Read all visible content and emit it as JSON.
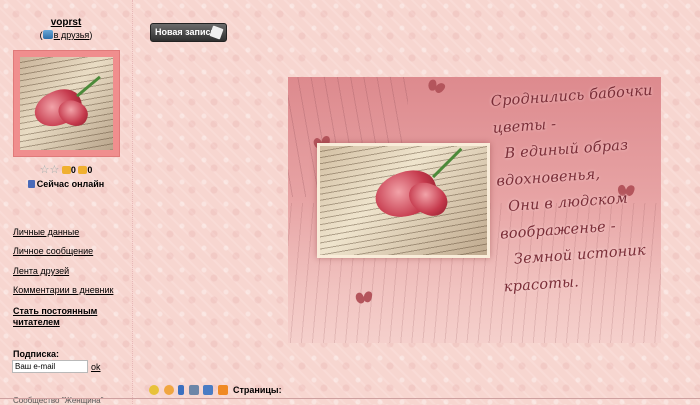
{
  "profile": {
    "username": "voprst",
    "add_friends_label": "в друзья",
    "open_paren": "(",
    "close_paren": ")",
    "stats": {
      "count_a": "0",
      "count_b": "0"
    },
    "online_status": "Сейчас онлайн"
  },
  "nav": {
    "items": [
      "Личные данные",
      "Личное сообщение",
      "Лента друзей",
      "Комментарии в дневник",
      "Стать постоянным читателем"
    ]
  },
  "subscribe": {
    "label": "Подписка:",
    "email_value": "Ваш e-mail",
    "ok_label": "ok",
    "cutoff_text": "Сообщество \"Женщина\""
  },
  "toolbar": {
    "new_post_label": "Новая запись",
    "pages_label": "Страницы:"
  },
  "post": {
    "poem_lines": [
      "Сроднились бабочки",
      "цветы -",
      "В единый образ",
      "вдохновенья,",
      "Они в людском",
      "воображенье -",
      "Земной истоник",
      "красоты."
    ]
  },
  "colors": {
    "background": "#f7d6d0",
    "avatar_frame": "#f08e8e",
    "button_dark": "#2f2f2f",
    "poem_text": "#7a2d37"
  }
}
